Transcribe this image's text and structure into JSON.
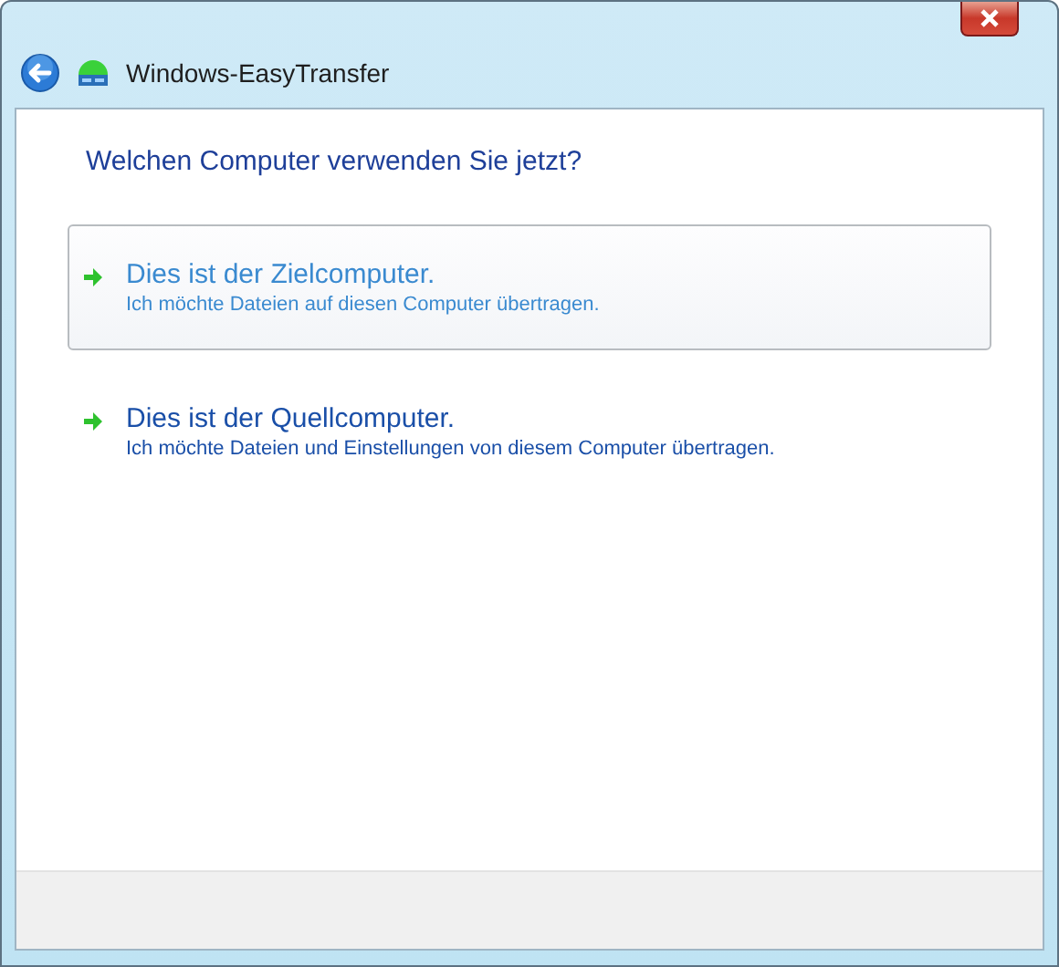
{
  "window": {
    "title": "Windows-EasyTransfer"
  },
  "heading": "Welchen Computer verwenden Sie jetzt?",
  "options": [
    {
      "title": "Dies ist der Zielcomputer.",
      "description": "Ich möchte Dateien auf diesen Computer übertragen.",
      "highlighted": true
    },
    {
      "title": "Dies ist der Quellcomputer.",
      "description": "Ich möchte Dateien und Einstellungen von diesem Computer übertragen.",
      "highlighted": false
    }
  ]
}
